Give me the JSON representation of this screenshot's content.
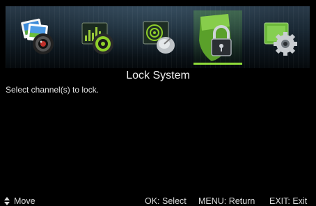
{
  "menu": {
    "items": [
      {
        "icon": "picture-icon",
        "selected": false
      },
      {
        "icon": "sound-icon",
        "selected": false
      },
      {
        "icon": "channel-icon",
        "selected": false
      },
      {
        "icon": "lock-icon",
        "selected": true
      },
      {
        "icon": "setup-icon",
        "selected": false
      }
    ]
  },
  "screen": {
    "title": "Lock System",
    "instruction": "Select channel(s) to lock."
  },
  "footer": {
    "move": "Move",
    "select": "OK: Select",
    "return": "MENU: Return",
    "exit": "EXIT: Exit"
  },
  "colors": {
    "background": "#000000",
    "accent": "#8fdc3a",
    "text": "#e8e8e8"
  }
}
